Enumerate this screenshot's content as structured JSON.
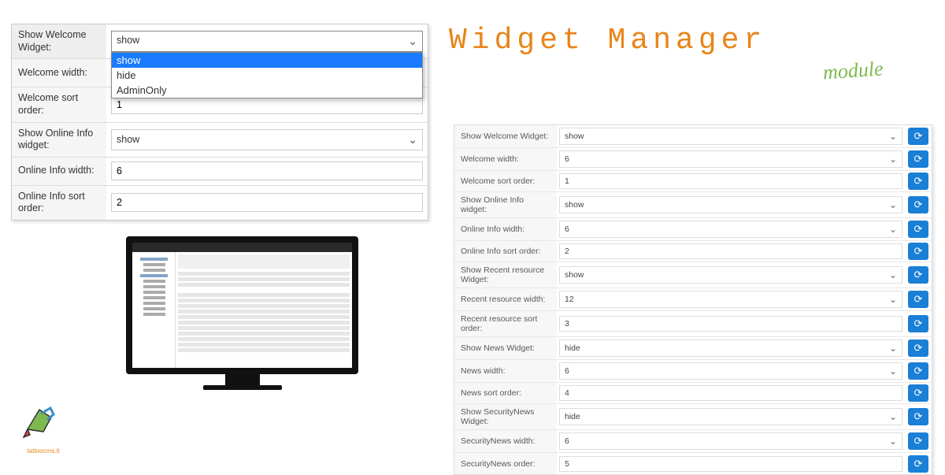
{
  "title": {
    "main": "Widget Manager",
    "sub": "module"
  },
  "logo_text": "tattoocms.it",
  "left_panel": {
    "rows": [
      {
        "label": "Show Welcome Widget:",
        "type": "select_open",
        "value": "show",
        "options": [
          "show",
          "hide",
          "AdminOnly"
        ],
        "selected": "show"
      },
      {
        "label": "Welcome width:",
        "type": "text",
        "value": ""
      },
      {
        "label": "Welcome sort order:",
        "type": "text",
        "value": "1"
      },
      {
        "label": "Show Online Info widget:",
        "type": "select",
        "value": "show"
      },
      {
        "label": "Online Info width:",
        "type": "text",
        "value": "6"
      },
      {
        "label": "Online Info sort order:",
        "type": "text",
        "value": "2"
      }
    ]
  },
  "right_panel": {
    "rows": [
      {
        "label": "Show Welcome Widget:",
        "type": "select",
        "value": "show"
      },
      {
        "label": "Welcome width:",
        "type": "select",
        "value": "6"
      },
      {
        "label": "Welcome sort order:",
        "type": "text",
        "value": "1"
      },
      {
        "label": "Show Online Info widget:",
        "type": "select",
        "value": "show"
      },
      {
        "label": "Online Info width:",
        "type": "select",
        "value": "6"
      },
      {
        "label": "Online Info sort order:",
        "type": "text",
        "value": "2"
      },
      {
        "label": "Show Recent resource Widget:",
        "type": "select",
        "value": "show"
      },
      {
        "label": "Recent resource width:",
        "type": "select",
        "value": "12"
      },
      {
        "label": "Recent resource sort order:",
        "type": "text",
        "value": "3"
      },
      {
        "label": "Show News Widget:",
        "type": "select",
        "value": "hide"
      },
      {
        "label": "News width:",
        "type": "select",
        "value": "6"
      },
      {
        "label": "News sort order:",
        "type": "text",
        "value": "4"
      },
      {
        "label": "Show SecurityNews Widget:",
        "type": "select",
        "value": "hide"
      },
      {
        "label": "SecurityNews width:",
        "type": "select",
        "value": "6"
      },
      {
        "label": "SecurityNews order:",
        "type": "text",
        "value": "5"
      }
    ]
  }
}
